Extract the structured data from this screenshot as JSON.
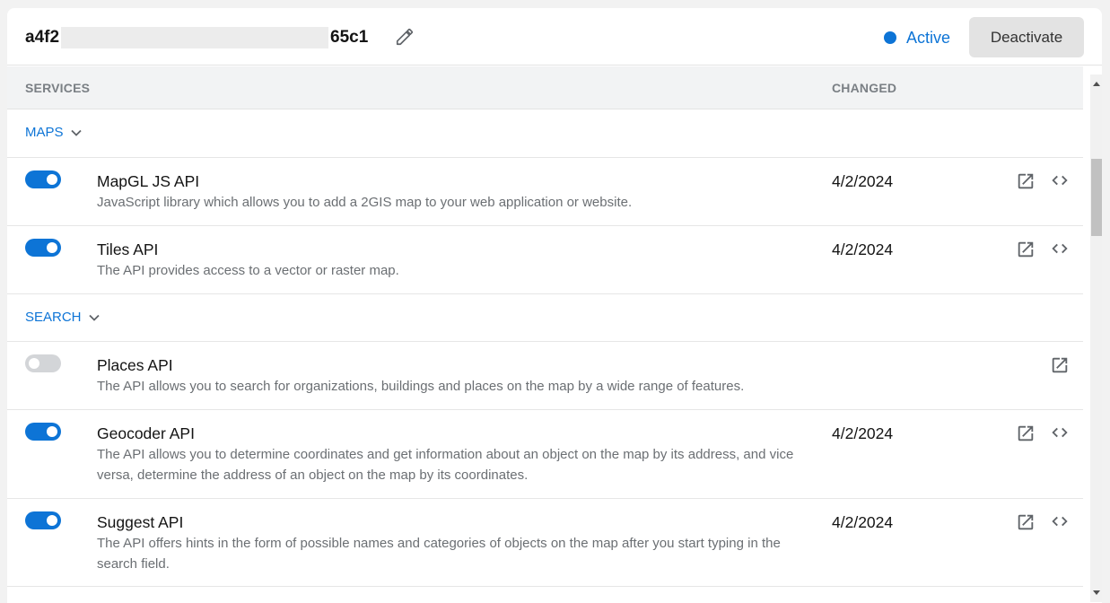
{
  "header": {
    "key_prefix": "a4f2",
    "key_suffix": "65c1",
    "status_label": "Active",
    "deactivate_label": "Deactivate"
  },
  "table": {
    "col_services": "SERVICES",
    "col_changed": "CHANGED"
  },
  "groups": [
    {
      "label": "MAPS",
      "items": [
        {
          "name": "MapGL JS API",
          "desc": "JavaScript library which allows you to add a 2GIS map to your web application or website.",
          "date": "4/2/2024",
          "enabled": true,
          "has_code": true
        },
        {
          "name": "Tiles API",
          "desc": "The API provides access to a vector or raster map.",
          "date": "4/2/2024",
          "enabled": true,
          "has_code": true
        }
      ]
    },
    {
      "label": "SEARCH",
      "items": [
        {
          "name": "Places API",
          "desc": "The API allows you to search for organizations, buildings and places on the map by a wide range of features.",
          "date": "",
          "enabled": false,
          "has_code": false
        },
        {
          "name": "Geocoder API",
          "desc": "The API allows you to determine coordinates and get information about an object on the map by its address, and vice versa, determine the address of an object on the map by its coordinates.",
          "date": "4/2/2024",
          "enabled": true,
          "has_code": true
        },
        {
          "name": "Suggest API",
          "desc": "The API offers hints in the form of possible names and categories of objects on the map after you start typing in the search field.",
          "date": "4/2/2024",
          "enabled": true,
          "has_code": true
        }
      ]
    }
  ],
  "icons": {
    "edit": "pencil-icon",
    "status": "status-dot-icon",
    "group_toggle": "chevron-down-icon",
    "open": "external-link-icon",
    "code": "code-icon"
  },
  "colors": {
    "accent": "#0d74d6",
    "toggle_off": "#d3d5d8",
    "header_bg": "#f2f3f4",
    "deactivate_bg": "#e3e3e3"
  }
}
